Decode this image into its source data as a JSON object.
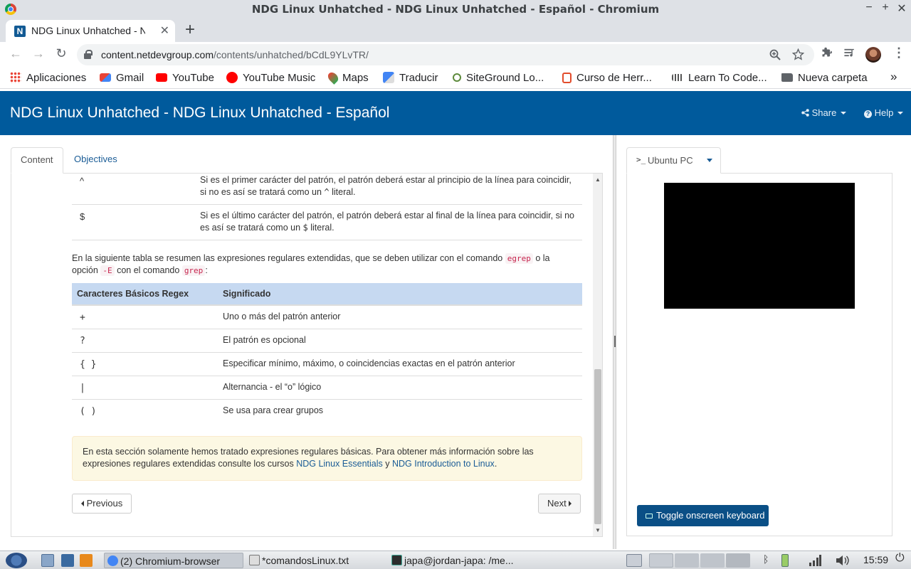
{
  "window": {
    "title": "NDG Linux Unhatched - NDG Linux Unhatched - Español - Chromium",
    "controls": {
      "minimize": "−",
      "maximize": "+",
      "close": "✕"
    }
  },
  "browser": {
    "tab": {
      "favicon": "N",
      "title": "NDG Linux Unhatched - NDG Linux Unhatched - Español",
      "close": "✕"
    },
    "new_tab": "+",
    "nav": {
      "back": "←",
      "forward": "→",
      "reload": "↻"
    },
    "url": {
      "host": "content.netdevgroup.com",
      "path": "/contents/unhatched/bCdL9YLvTR/"
    },
    "bookmarks": [
      {
        "label": "Aplicaciones",
        "icon": "apps-grid-icon",
        "color": "#ea4335"
      },
      {
        "label": "Gmail",
        "icon": "gmail-icon",
        "color": "#ea4335"
      },
      {
        "label": "YouTube",
        "icon": "youtube-icon",
        "color": "#ff0000"
      },
      {
        "label": "YouTube Music",
        "icon": "youtube-music-icon",
        "color": "#ff0000"
      },
      {
        "label": "Maps",
        "icon": "maps-pin-icon",
        "color": "#34a853"
      },
      {
        "label": "Traducir",
        "icon": "translate-icon",
        "color": "#4285f4"
      },
      {
        "label": "SiteGround Lo...",
        "icon": "siteground-icon",
        "color": "#5d8a3c"
      },
      {
        "label": "Curso de Herr...",
        "icon": "course-icon",
        "color": "#e24c2c"
      },
      {
        "label": "Learn To Code...",
        "icon": "cisco-icon",
        "color": "#555555"
      },
      {
        "label": "Nueva carpeta",
        "icon": "folder-icon",
        "color": "#5f6368"
      }
    ],
    "bookmarks_more": "»"
  },
  "app": {
    "title": "NDG Linux Unhatched - NDG Linux Unhatched - Español",
    "share_label": "Share",
    "help_label": "Help",
    "tabs": [
      "Content",
      "Objectives"
    ]
  },
  "content": {
    "anchor_rows": [
      {
        "symbol": "^",
        "text_a": "Si es el primer carácter del patrón, el patrón deberá estar al principio de la línea para coincidir, si no es así se tratará como un",
        "code": "^",
        "text_b": "literal."
      },
      {
        "symbol": "$",
        "text_a": "Si es el último carácter del patrón, el patrón deberá estar al final de la línea para coincidir, si no es así se tratará como un",
        "code": "$",
        "text_b": "literal."
      }
    ],
    "intro": {
      "part1": "En la siguiente tabla se resumen las expresiones regulares extendidas, que se deben utilizar con el comando",
      "code1": "egrep",
      "part2": "o la opción",
      "code2": "-E",
      "part3": "con el comando",
      "code3": "grep",
      "part4": ":"
    },
    "table": {
      "headers": [
        "Caracteres Básicos Regex",
        "Significado"
      ],
      "rows": [
        [
          "+",
          "Uno o más del patrón anterior"
        ],
        [
          "?",
          "El patrón es opcional"
        ],
        [
          "{ }",
          "Especificar mínimo, máximo, o coincidencias exactas en el patrón anterior"
        ],
        [
          "|",
          "Alternancia - el “o” lógico"
        ],
        [
          "( )",
          "Se usa para crear grupos"
        ]
      ]
    },
    "note": {
      "text1": "En esta sección solamente hemos tratado expresiones regulares básicas. Para obtener más información sobre las expresiones regulares extendidas consulte los cursos",
      "link1": "NDG Linux Essentials",
      "mid": "y",
      "link2": "NDG Introduction to Linux",
      "end": "."
    },
    "prev_label": "Previous",
    "next_label": "Next"
  },
  "vm": {
    "tab_label": "Ubuntu PC",
    "term_glyph": ">_",
    "keyboard_button": "Toggle onscreen keyboard"
  },
  "taskbar": {
    "tasks": [
      {
        "label": "(2) Chromium-browser",
        "icon": "chromium-icon"
      },
      {
        "label": "*comandosLinux.txt",
        "icon": "text-editor-icon"
      },
      {
        "label": "japa@jordan-japa: /me...",
        "icon": "terminal-icon"
      }
    ],
    "clock": "15:59"
  }
}
